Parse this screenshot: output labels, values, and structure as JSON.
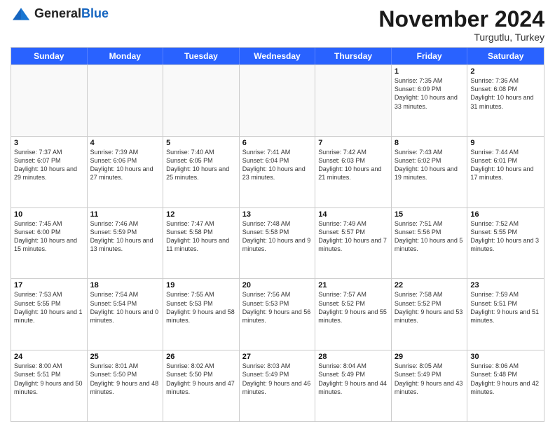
{
  "header": {
    "logo_general": "General",
    "logo_blue": "Blue",
    "month_title": "November 2024",
    "location": "Turgutlu, Turkey"
  },
  "days_of_week": [
    "Sunday",
    "Monday",
    "Tuesday",
    "Wednesday",
    "Thursday",
    "Friday",
    "Saturday"
  ],
  "weeks": [
    [
      {
        "day": "",
        "info": ""
      },
      {
        "day": "",
        "info": ""
      },
      {
        "day": "",
        "info": ""
      },
      {
        "day": "",
        "info": ""
      },
      {
        "day": "",
        "info": ""
      },
      {
        "day": "1",
        "info": "Sunrise: 7:35 AM\nSunset: 6:09 PM\nDaylight: 10 hours and 33 minutes."
      },
      {
        "day": "2",
        "info": "Sunrise: 7:36 AM\nSunset: 6:08 PM\nDaylight: 10 hours and 31 minutes."
      }
    ],
    [
      {
        "day": "3",
        "info": "Sunrise: 7:37 AM\nSunset: 6:07 PM\nDaylight: 10 hours and 29 minutes."
      },
      {
        "day": "4",
        "info": "Sunrise: 7:39 AM\nSunset: 6:06 PM\nDaylight: 10 hours and 27 minutes."
      },
      {
        "day": "5",
        "info": "Sunrise: 7:40 AM\nSunset: 6:05 PM\nDaylight: 10 hours and 25 minutes."
      },
      {
        "day": "6",
        "info": "Sunrise: 7:41 AM\nSunset: 6:04 PM\nDaylight: 10 hours and 23 minutes."
      },
      {
        "day": "7",
        "info": "Sunrise: 7:42 AM\nSunset: 6:03 PM\nDaylight: 10 hours and 21 minutes."
      },
      {
        "day": "8",
        "info": "Sunrise: 7:43 AM\nSunset: 6:02 PM\nDaylight: 10 hours and 19 minutes."
      },
      {
        "day": "9",
        "info": "Sunrise: 7:44 AM\nSunset: 6:01 PM\nDaylight: 10 hours and 17 minutes."
      }
    ],
    [
      {
        "day": "10",
        "info": "Sunrise: 7:45 AM\nSunset: 6:00 PM\nDaylight: 10 hours and 15 minutes."
      },
      {
        "day": "11",
        "info": "Sunrise: 7:46 AM\nSunset: 5:59 PM\nDaylight: 10 hours and 13 minutes."
      },
      {
        "day": "12",
        "info": "Sunrise: 7:47 AM\nSunset: 5:58 PM\nDaylight: 10 hours and 11 minutes."
      },
      {
        "day": "13",
        "info": "Sunrise: 7:48 AM\nSunset: 5:58 PM\nDaylight: 10 hours and 9 minutes."
      },
      {
        "day": "14",
        "info": "Sunrise: 7:49 AM\nSunset: 5:57 PM\nDaylight: 10 hours and 7 minutes."
      },
      {
        "day": "15",
        "info": "Sunrise: 7:51 AM\nSunset: 5:56 PM\nDaylight: 10 hours and 5 minutes."
      },
      {
        "day": "16",
        "info": "Sunrise: 7:52 AM\nSunset: 5:55 PM\nDaylight: 10 hours and 3 minutes."
      }
    ],
    [
      {
        "day": "17",
        "info": "Sunrise: 7:53 AM\nSunset: 5:55 PM\nDaylight: 10 hours and 1 minute."
      },
      {
        "day": "18",
        "info": "Sunrise: 7:54 AM\nSunset: 5:54 PM\nDaylight: 10 hours and 0 minutes."
      },
      {
        "day": "19",
        "info": "Sunrise: 7:55 AM\nSunset: 5:53 PM\nDaylight: 9 hours and 58 minutes."
      },
      {
        "day": "20",
        "info": "Sunrise: 7:56 AM\nSunset: 5:53 PM\nDaylight: 9 hours and 56 minutes."
      },
      {
        "day": "21",
        "info": "Sunrise: 7:57 AM\nSunset: 5:52 PM\nDaylight: 9 hours and 55 minutes."
      },
      {
        "day": "22",
        "info": "Sunrise: 7:58 AM\nSunset: 5:52 PM\nDaylight: 9 hours and 53 minutes."
      },
      {
        "day": "23",
        "info": "Sunrise: 7:59 AM\nSunset: 5:51 PM\nDaylight: 9 hours and 51 minutes."
      }
    ],
    [
      {
        "day": "24",
        "info": "Sunrise: 8:00 AM\nSunset: 5:51 PM\nDaylight: 9 hours and 50 minutes."
      },
      {
        "day": "25",
        "info": "Sunrise: 8:01 AM\nSunset: 5:50 PM\nDaylight: 9 hours and 48 minutes."
      },
      {
        "day": "26",
        "info": "Sunrise: 8:02 AM\nSunset: 5:50 PM\nDaylight: 9 hours and 47 minutes."
      },
      {
        "day": "27",
        "info": "Sunrise: 8:03 AM\nSunset: 5:49 PM\nDaylight: 9 hours and 46 minutes."
      },
      {
        "day": "28",
        "info": "Sunrise: 8:04 AM\nSunset: 5:49 PM\nDaylight: 9 hours and 44 minutes."
      },
      {
        "day": "29",
        "info": "Sunrise: 8:05 AM\nSunset: 5:49 PM\nDaylight: 9 hours and 43 minutes."
      },
      {
        "day": "30",
        "info": "Sunrise: 8:06 AM\nSunset: 5:48 PM\nDaylight: 9 hours and 42 minutes."
      }
    ]
  ]
}
